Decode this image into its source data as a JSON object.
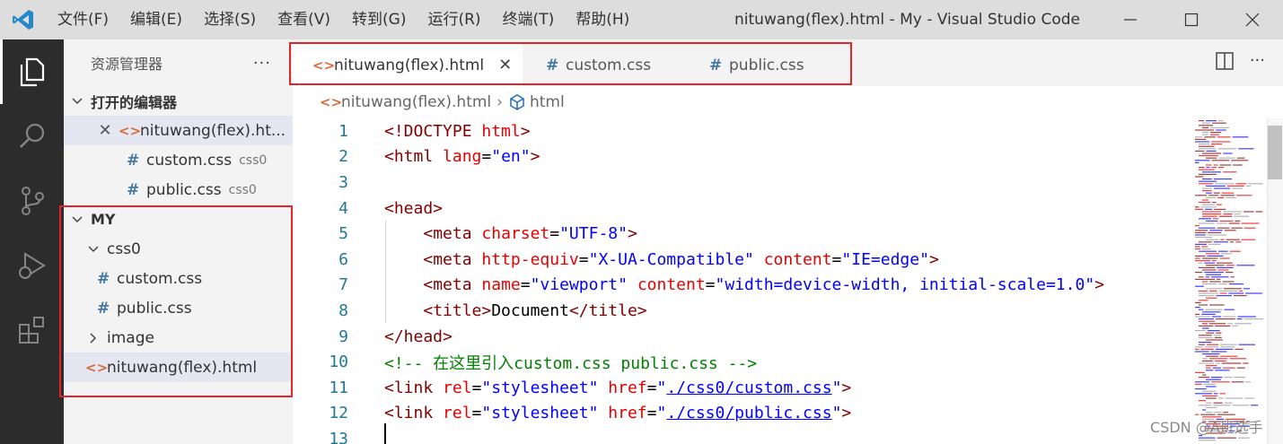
{
  "window": {
    "title": "nituwang(flex).html - My - Visual Studio Code",
    "menu": [
      "文件(F)",
      "编辑(E)",
      "选择(S)",
      "查看(V)",
      "转到(G)",
      "运行(R)",
      "终端(T)",
      "帮助(H)"
    ]
  },
  "sidebar": {
    "title": "资源管理器",
    "more": "···",
    "open_editors": {
      "label": "打开的编辑器",
      "items": [
        {
          "name": "nituwang(flex).ht...",
          "desc": ""
        },
        {
          "name": "custom.css",
          "desc": "css0"
        },
        {
          "name": "public.css",
          "desc": "css0"
        }
      ]
    },
    "workspace": {
      "label": "MY",
      "folder_css0": "css0",
      "files_css0": [
        "custom.css",
        "public.css"
      ],
      "folder_image": "image",
      "root_file": "nituwang(flex).html"
    }
  },
  "tabs": [
    {
      "label": "nituwang(flex).html",
      "active": true
    },
    {
      "label": "custom.css",
      "active": false
    },
    {
      "label": "public.css",
      "active": false
    }
  ],
  "breadcrumb": {
    "file": "nituwang(flex).html",
    "symbol": "html"
  },
  "editor": {
    "line_numbers": [
      "1",
      "2",
      "3",
      "4",
      "5",
      "6",
      "7",
      "8",
      "9",
      "10",
      "11",
      "12",
      "13"
    ],
    "lines": [
      [
        {
          "t": "tag",
          "v": "<!DOCTYPE "
        },
        {
          "t": "attr",
          "v": "html"
        },
        {
          "t": "tag",
          "v": ">"
        }
      ],
      [
        {
          "t": "tag",
          "v": "<html "
        },
        {
          "t": "attr",
          "v": "lang"
        },
        {
          "t": "txt",
          "v": "="
        },
        {
          "t": "str",
          "v": "\"en\""
        },
        {
          "t": "tag",
          "v": ">"
        }
      ],
      [],
      [
        {
          "t": "tag",
          "v": "<head>"
        }
      ],
      [
        {
          "t": "txt",
          "v": "    "
        },
        {
          "t": "tag",
          "v": "<meta "
        },
        {
          "t": "attr",
          "v": "charset"
        },
        {
          "t": "txt",
          "v": "="
        },
        {
          "t": "str",
          "v": "\"UTF-8\""
        },
        {
          "t": "tag",
          "v": ">"
        }
      ],
      [
        {
          "t": "txt",
          "v": "    "
        },
        {
          "t": "tag",
          "v": "<meta "
        },
        {
          "t": "attr",
          "v": "http-equiv"
        },
        {
          "t": "txt",
          "v": "="
        },
        {
          "t": "str",
          "v": "\"X-UA-Compatible\""
        },
        {
          "t": "txt",
          "v": " "
        },
        {
          "t": "attr",
          "v": "content"
        },
        {
          "t": "txt",
          "v": "="
        },
        {
          "t": "str",
          "v": "\"IE=edge\""
        },
        {
          "t": "tag",
          "v": ">"
        }
      ],
      [
        {
          "t": "txt",
          "v": "    "
        },
        {
          "t": "tag",
          "v": "<meta "
        },
        {
          "t": "attr",
          "v": "name"
        },
        {
          "t": "txt",
          "v": "="
        },
        {
          "t": "str",
          "v": "\"viewport\""
        },
        {
          "t": "txt",
          "v": " "
        },
        {
          "t": "attr",
          "v": "content"
        },
        {
          "t": "txt",
          "v": "="
        },
        {
          "t": "str",
          "v": "\"width=device-width, initial-scale=1.0\""
        },
        {
          "t": "tag",
          "v": ">"
        }
      ],
      [
        {
          "t": "txt",
          "v": "    "
        },
        {
          "t": "tag",
          "v": "<title>"
        },
        {
          "t": "txt",
          "v": "Document"
        },
        {
          "t": "tag",
          "v": "</title>"
        }
      ],
      [
        {
          "t": "tag",
          "v": "</head>"
        }
      ],
      [
        {
          "t": "com",
          "v": "<!-- 在这里引入custom.css public.css -->"
        }
      ],
      [
        {
          "t": "tag",
          "v": "<link "
        },
        {
          "t": "attr",
          "v": "rel"
        },
        {
          "t": "txt",
          "v": "="
        },
        {
          "t": "str",
          "v": "\"stylesheet\""
        },
        {
          "t": "txt",
          "v": " "
        },
        {
          "t": "attr",
          "v": "href"
        },
        {
          "t": "txt",
          "v": "="
        },
        {
          "t": "str",
          "v": "\""
        },
        {
          "t": "link",
          "v": "./css0/custom.css"
        },
        {
          "t": "str",
          "v": "\""
        },
        {
          "t": "tag",
          "v": ">"
        }
      ],
      [
        {
          "t": "tag",
          "v": "<link "
        },
        {
          "t": "attr",
          "v": "rel"
        },
        {
          "t": "txt",
          "v": "="
        },
        {
          "t": "str",
          "v": "\"stylesheet\""
        },
        {
          "t": "txt",
          "v": " "
        },
        {
          "t": "attr",
          "v": "href"
        },
        {
          "t": "txt",
          "v": "="
        },
        {
          "t": "str",
          "v": "\""
        },
        {
          "t": "link",
          "v": "./css0/public.css"
        },
        {
          "t": "str",
          "v": "\""
        },
        {
          "t": "tag",
          "v": ">"
        }
      ],
      []
    ]
  },
  "watermark": "CSDN @A班选手",
  "colors": {
    "highlight_box": "#e3242b",
    "activity_bar": "#2c2c2c",
    "tag": "#800000",
    "attr": "#e50000",
    "string": "#0000ff",
    "comment": "#008000"
  }
}
